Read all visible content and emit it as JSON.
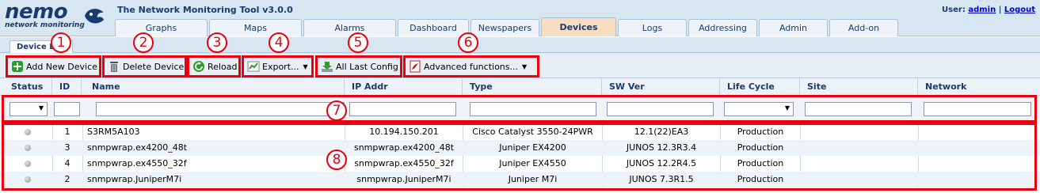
{
  "app": {
    "logo_word": "nemo",
    "logo_sub": "network monitoring",
    "title": "The Network Monitoring Tool v3.0.0",
    "user_label": "User:",
    "user_name": "admin",
    "separator": "|",
    "logout_label": "Logout"
  },
  "tabs": [
    "Graphs",
    "Maps",
    "Alarms",
    "Dashboard",
    "Newspapers",
    "Devices",
    "Logs",
    "Addressing",
    "Admin",
    "Add-on"
  ],
  "active_tab": "Devices",
  "subtab": {
    "label": "Device List"
  },
  "toolbar": {
    "add": "Add New Device",
    "delete": "Delete Device",
    "reload": "Reload",
    "export": "Export...",
    "all_last_config": "All Last Config",
    "advanced": "Advanced functions..."
  },
  "columns": [
    "Status",
    "ID",
    "Name",
    "IP Addr",
    "Type",
    "SW Ver",
    "Life Cycle",
    "Site",
    "Network"
  ],
  "rows": [
    {
      "id": "1",
      "name": "S3RM5A103",
      "ip": "10.194.150.201",
      "type": "Cisco Catalyst 3550-24PWR",
      "sw": "12.1(22)EA3",
      "lifecycle": "Production",
      "site": "",
      "network": ""
    },
    {
      "id": "3",
      "name": "snmpwrap.ex4200_48t",
      "ip": "snmpwrap.ex4200_48t",
      "type": "Juniper EX4200",
      "sw": "JUNOS 12.3R3.4",
      "lifecycle": "Production",
      "site": "",
      "network": ""
    },
    {
      "id": "4",
      "name": "snmpwrap.ex4550_32f",
      "ip": "snmpwrap.ex4550_32f",
      "type": "Juniper EX4550",
      "sw": "JUNOS 12.2R4.5",
      "lifecycle": "Production",
      "site": "",
      "network": ""
    },
    {
      "id": "2",
      "name": "snmpwrap.JuniperM7i",
      "ip": "snmpwrap.JuniperM7i",
      "type": "Juniper M7i",
      "sw": "JUNOS 7.3R1.5",
      "lifecycle": "Production",
      "site": "",
      "network": ""
    }
  ],
  "annotations": [
    "1",
    "2",
    "3",
    "4",
    "5",
    "6",
    "7",
    "8"
  ],
  "colors": {
    "annotation_red": "#e8000f",
    "header_bg": "#d8e6f2",
    "active_tab": "#f6dcc0",
    "brand_navy": "#1a3b6e"
  },
  "icons": {
    "add": "add-plus-icon",
    "delete": "trash-icon",
    "reload": "reload-icon",
    "export": "export-chart-icon",
    "all_last_config": "download-icon",
    "advanced": "pdf-tools-icon"
  }
}
